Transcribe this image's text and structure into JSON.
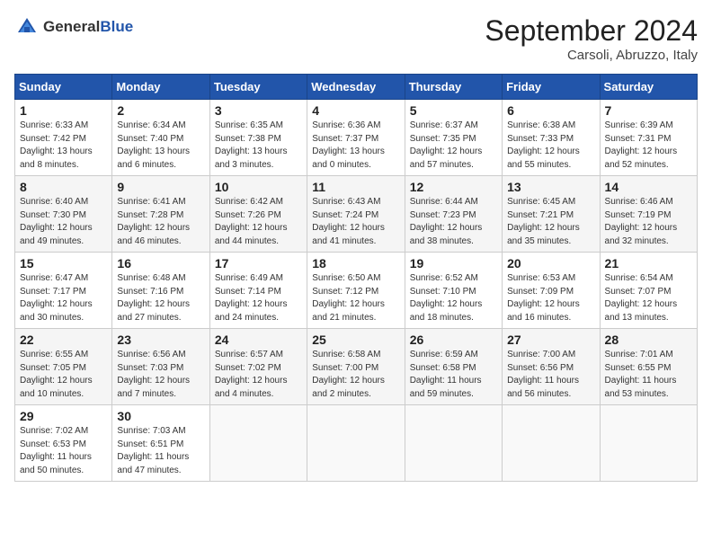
{
  "header": {
    "logo_general": "General",
    "logo_blue": "Blue",
    "month_title": "September 2024",
    "location": "Carsoli, Abruzzo, Italy"
  },
  "days_of_week": [
    "Sunday",
    "Monday",
    "Tuesday",
    "Wednesday",
    "Thursday",
    "Friday",
    "Saturday"
  ],
  "weeks": [
    [
      {
        "num": "1",
        "sunrise": "Sunrise: 6:33 AM",
        "sunset": "Sunset: 7:42 PM",
        "daylight": "Daylight: 13 hours and 8 minutes."
      },
      {
        "num": "2",
        "sunrise": "Sunrise: 6:34 AM",
        "sunset": "Sunset: 7:40 PM",
        "daylight": "Daylight: 13 hours and 6 minutes."
      },
      {
        "num": "3",
        "sunrise": "Sunrise: 6:35 AM",
        "sunset": "Sunset: 7:38 PM",
        "daylight": "Daylight: 13 hours and 3 minutes."
      },
      {
        "num": "4",
        "sunrise": "Sunrise: 6:36 AM",
        "sunset": "Sunset: 7:37 PM",
        "daylight": "Daylight: 13 hours and 0 minutes."
      },
      {
        "num": "5",
        "sunrise": "Sunrise: 6:37 AM",
        "sunset": "Sunset: 7:35 PM",
        "daylight": "Daylight: 12 hours and 57 minutes."
      },
      {
        "num": "6",
        "sunrise": "Sunrise: 6:38 AM",
        "sunset": "Sunset: 7:33 PM",
        "daylight": "Daylight: 12 hours and 55 minutes."
      },
      {
        "num": "7",
        "sunrise": "Sunrise: 6:39 AM",
        "sunset": "Sunset: 7:31 PM",
        "daylight": "Daylight: 12 hours and 52 minutes."
      }
    ],
    [
      {
        "num": "8",
        "sunrise": "Sunrise: 6:40 AM",
        "sunset": "Sunset: 7:30 PM",
        "daylight": "Daylight: 12 hours and 49 minutes."
      },
      {
        "num": "9",
        "sunrise": "Sunrise: 6:41 AM",
        "sunset": "Sunset: 7:28 PM",
        "daylight": "Daylight: 12 hours and 46 minutes."
      },
      {
        "num": "10",
        "sunrise": "Sunrise: 6:42 AM",
        "sunset": "Sunset: 7:26 PM",
        "daylight": "Daylight: 12 hours and 44 minutes."
      },
      {
        "num": "11",
        "sunrise": "Sunrise: 6:43 AM",
        "sunset": "Sunset: 7:24 PM",
        "daylight": "Daylight: 12 hours and 41 minutes."
      },
      {
        "num": "12",
        "sunrise": "Sunrise: 6:44 AM",
        "sunset": "Sunset: 7:23 PM",
        "daylight": "Daylight: 12 hours and 38 minutes."
      },
      {
        "num": "13",
        "sunrise": "Sunrise: 6:45 AM",
        "sunset": "Sunset: 7:21 PM",
        "daylight": "Daylight: 12 hours and 35 minutes."
      },
      {
        "num": "14",
        "sunrise": "Sunrise: 6:46 AM",
        "sunset": "Sunset: 7:19 PM",
        "daylight": "Daylight: 12 hours and 32 minutes."
      }
    ],
    [
      {
        "num": "15",
        "sunrise": "Sunrise: 6:47 AM",
        "sunset": "Sunset: 7:17 PM",
        "daylight": "Daylight: 12 hours and 30 minutes."
      },
      {
        "num": "16",
        "sunrise": "Sunrise: 6:48 AM",
        "sunset": "Sunset: 7:16 PM",
        "daylight": "Daylight: 12 hours and 27 minutes."
      },
      {
        "num": "17",
        "sunrise": "Sunrise: 6:49 AM",
        "sunset": "Sunset: 7:14 PM",
        "daylight": "Daylight: 12 hours and 24 minutes."
      },
      {
        "num": "18",
        "sunrise": "Sunrise: 6:50 AM",
        "sunset": "Sunset: 7:12 PM",
        "daylight": "Daylight: 12 hours and 21 minutes."
      },
      {
        "num": "19",
        "sunrise": "Sunrise: 6:52 AM",
        "sunset": "Sunset: 7:10 PM",
        "daylight": "Daylight: 12 hours and 18 minutes."
      },
      {
        "num": "20",
        "sunrise": "Sunrise: 6:53 AM",
        "sunset": "Sunset: 7:09 PM",
        "daylight": "Daylight: 12 hours and 16 minutes."
      },
      {
        "num": "21",
        "sunrise": "Sunrise: 6:54 AM",
        "sunset": "Sunset: 7:07 PM",
        "daylight": "Daylight: 12 hours and 13 minutes."
      }
    ],
    [
      {
        "num": "22",
        "sunrise": "Sunrise: 6:55 AM",
        "sunset": "Sunset: 7:05 PM",
        "daylight": "Daylight: 12 hours and 10 minutes."
      },
      {
        "num": "23",
        "sunrise": "Sunrise: 6:56 AM",
        "sunset": "Sunset: 7:03 PM",
        "daylight": "Daylight: 12 hours and 7 minutes."
      },
      {
        "num": "24",
        "sunrise": "Sunrise: 6:57 AM",
        "sunset": "Sunset: 7:02 PM",
        "daylight": "Daylight: 12 hours and 4 minutes."
      },
      {
        "num": "25",
        "sunrise": "Sunrise: 6:58 AM",
        "sunset": "Sunset: 7:00 PM",
        "daylight": "Daylight: 12 hours and 2 minutes."
      },
      {
        "num": "26",
        "sunrise": "Sunrise: 6:59 AM",
        "sunset": "Sunset: 6:58 PM",
        "daylight": "Daylight: 11 hours and 59 minutes."
      },
      {
        "num": "27",
        "sunrise": "Sunrise: 7:00 AM",
        "sunset": "Sunset: 6:56 PM",
        "daylight": "Daylight: 11 hours and 56 minutes."
      },
      {
        "num": "28",
        "sunrise": "Sunrise: 7:01 AM",
        "sunset": "Sunset: 6:55 PM",
        "daylight": "Daylight: 11 hours and 53 minutes."
      }
    ],
    [
      {
        "num": "29",
        "sunrise": "Sunrise: 7:02 AM",
        "sunset": "Sunset: 6:53 PM",
        "daylight": "Daylight: 11 hours and 50 minutes."
      },
      {
        "num": "30",
        "sunrise": "Sunrise: 7:03 AM",
        "sunset": "Sunset: 6:51 PM",
        "daylight": "Daylight: 11 hours and 47 minutes."
      },
      null,
      null,
      null,
      null,
      null
    ]
  ]
}
